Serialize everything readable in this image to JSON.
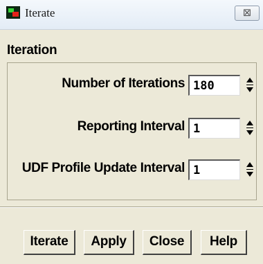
{
  "window": {
    "title": "Iterate",
    "close_glyph": "⊠"
  },
  "group": {
    "title": "Iteration",
    "rows": [
      {
        "label": "Number of Iterations",
        "value": "180"
      },
      {
        "label": "Reporting Interval",
        "value": "1"
      },
      {
        "label": "UDF Profile Update Interval",
        "value": "1"
      }
    ]
  },
  "buttons": {
    "iterate": "Iterate",
    "apply": "Apply",
    "close": "Close",
    "help": "Help"
  },
  "icons": {
    "app": "fluent-app-icon",
    "close": "close-icon",
    "spin_up": "arrow-up-icon",
    "spin_down": "arrow-down-icon"
  },
  "colors": {
    "dialog_background": "#ece9d8",
    "field_background": "#ffffff"
  }
}
